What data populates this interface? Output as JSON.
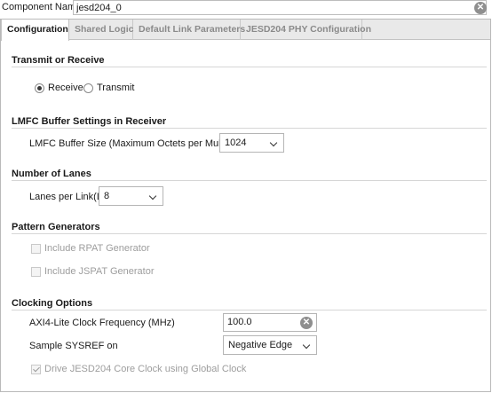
{
  "component": {
    "label": "Component Name",
    "value": "jesd204_0"
  },
  "tabs": [
    {
      "label": "Configuration",
      "active": true
    },
    {
      "label": "Shared Logic",
      "active": false
    },
    {
      "label": "Default Link Parameters",
      "active": false
    },
    {
      "label": "JESD204 PHY Configuration",
      "active": false
    }
  ],
  "sections": {
    "transmit_receive": {
      "title": "Transmit or Receive",
      "receive_label": "Receive",
      "transmit_label": "Transmit",
      "selected": "Receive"
    },
    "lmfc": {
      "title": "LMFC Buffer Settings in Receiver",
      "field_label": "LMFC Buffer Size (Maximum Octets per Multiframe)",
      "value": "1024"
    },
    "lanes": {
      "title": "Number of Lanes",
      "field_label": "Lanes per Link(L)",
      "value": "8"
    },
    "pattern": {
      "title": "Pattern Generators",
      "rpat_label": "Include RPAT Generator",
      "jspat_label": "Include JSPAT Generator",
      "rpat_checked": false,
      "jspat_checked": false
    },
    "clocking": {
      "title": "Clocking Options",
      "axi_label": "AXI4-Lite Clock Frequency (MHz)",
      "axi_value": "100.0",
      "sysref_label": "Sample SYSREF on",
      "sysref_value": "Negative Edge",
      "drive_label": "Drive JESD204 Core Clock using Global Clock",
      "drive_checked": true
    }
  },
  "icons": {
    "clear": "clear-icon",
    "dropdown": "chevron-down-icon"
  }
}
